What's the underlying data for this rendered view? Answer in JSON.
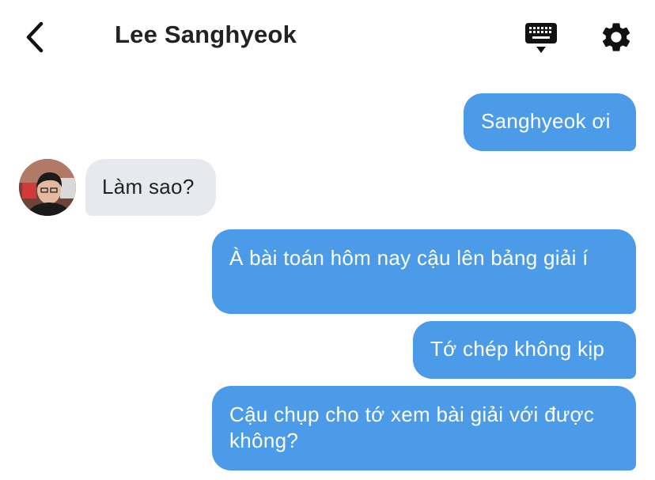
{
  "header": {
    "title": "Lee Sanghyeok",
    "back_icon": "chevron-left-icon",
    "keyboard_icon": "keyboard-icon",
    "settings_icon": "gear-icon"
  },
  "messages": [
    {
      "direction": "outgoing",
      "text": "Sanghyeok ơi"
    },
    {
      "direction": "incoming",
      "text": "Làm sao?"
    },
    {
      "direction": "outgoing",
      "text": "À bài toán hôm nay cậu lên bảng giải í"
    },
    {
      "direction": "outgoing",
      "text": "Tớ chép không kịp"
    },
    {
      "direction": "outgoing",
      "text": "Cậu chụp cho tớ xem bài giải với được không?"
    }
  ],
  "colors": {
    "outgoing_bubble": "#4b9be8",
    "incoming_bubble": "#e6eaee",
    "title_text": "#222222"
  }
}
